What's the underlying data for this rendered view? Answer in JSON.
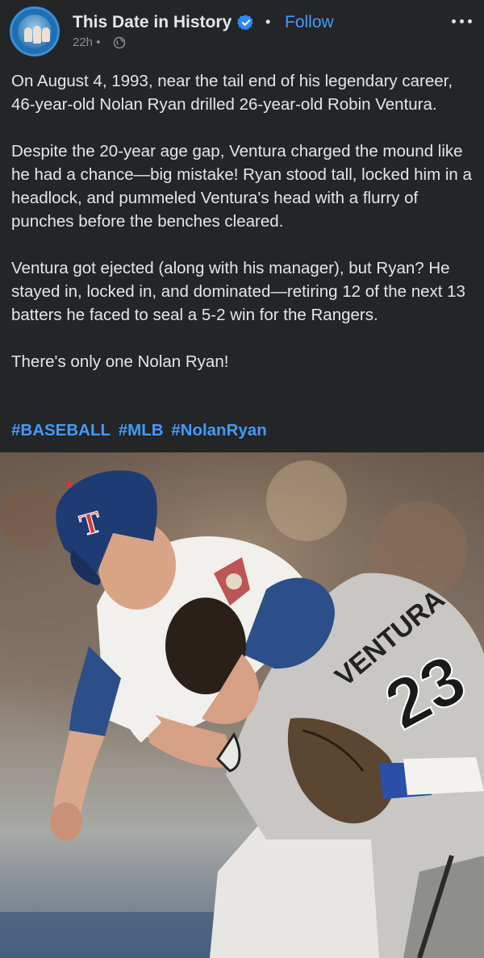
{
  "post": {
    "page_name": "This Date in History",
    "follow_label": "Follow",
    "separator": "•",
    "time": "22h •",
    "paragraphs": [
      "On August 4, 1993, near the tail end of his legendary career, 46-year-old Nolan Ryan drilled 26-year-old Robin Ventura.",
      "Despite the 20-year age gap, Ventura charged the mound like he had a chance—big mistake! Ryan stood tall, locked him in a headlock, and pummeled Ventura's head with a flurry of punches before the benches cleared.",
      "Ventura got ejected (along with his manager), but Ryan? He stayed in, locked in, and dominated—retiring 12 of the next 13 batters he faced to seal a 5-2 win for the Rangers.",
      "There's only one Nolan Ryan!"
    ],
    "hashtags": [
      "#BASEBALL",
      "#MLB",
      "#NolanRyan"
    ]
  },
  "photo": {
    "cap_letter": "T",
    "jersey_name": "VENTURA",
    "jersey_number": "23"
  },
  "colors": {
    "background": "#242526",
    "text": "#e4e6eb",
    "link": "#4599ff",
    "meta": "#8a8d91",
    "verified": "#2d88ff"
  },
  "icons": {
    "verified": "verified-badge-icon",
    "globe": "globe-icon",
    "more": "more-options-icon"
  }
}
